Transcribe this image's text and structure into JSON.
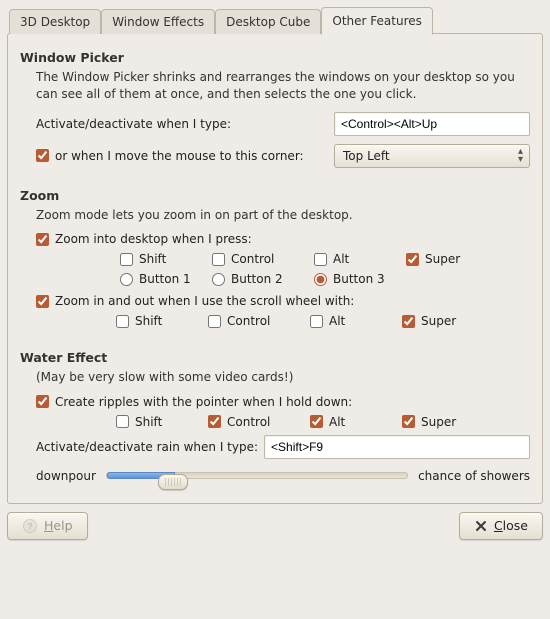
{
  "tabs": {
    "items": [
      "3D Desktop",
      "Window Effects",
      "Desktop Cube",
      "Other Features"
    ],
    "active_index": 3
  },
  "window_picker": {
    "title": "Window Picker",
    "desc": "The Window Picker shrinks and rearranges the windows on your desktop so you can see all of them at once, and then selects the one you click.",
    "activate_label": "Activate/deactivate when I type:",
    "activate_value": "<Control><Alt>Up",
    "corner_checked": true,
    "corner_label": "or when I move the mouse to this corner:",
    "corner_value": "Top Left"
  },
  "zoom": {
    "title": "Zoom",
    "desc": "Zoom mode lets you zoom in on part of the desktop.",
    "into_checked": true,
    "into_label": "Zoom into desktop when I press:",
    "mods": {
      "shift": {
        "label": "Shift",
        "checked": false
      },
      "control": {
        "label": "Control",
        "checked": false
      },
      "alt": {
        "label": "Alt",
        "checked": false
      },
      "super": {
        "label": "Super",
        "checked": true
      }
    },
    "buttons": {
      "b1": {
        "label": "Button 1",
        "selected": false
      },
      "b2": {
        "label": "Button 2",
        "selected": false
      },
      "b3": {
        "label": "Button 3",
        "selected": true
      }
    },
    "scroll_checked": true,
    "scroll_label": "Zoom in and out when I use the scroll wheel with:",
    "scroll_mods": {
      "shift": {
        "label": "Shift",
        "checked": false
      },
      "control": {
        "label": "Control",
        "checked": false
      },
      "alt": {
        "label": "Alt",
        "checked": false
      },
      "super": {
        "label": "Super",
        "checked": true
      }
    }
  },
  "water": {
    "title": "Water Effect",
    "note": "(May be very slow with some video cards!)",
    "ripples_checked": true,
    "ripples_label": "Create ripples with the pointer when I hold down:",
    "mods": {
      "shift": {
        "label": "Shift",
        "checked": false
      },
      "control": {
        "label": "Control",
        "checked": true
      },
      "alt": {
        "label": "Alt",
        "checked": true
      },
      "super": {
        "label": "Super",
        "checked": true
      }
    },
    "rain_label": "Activate/deactivate rain when I type:",
    "rain_value": "<Shift>F9",
    "slider_left": "downpour",
    "slider_right": "chance of showers",
    "slider_value_pct": 22
  },
  "buttons": {
    "help": "Help",
    "close": "Close"
  }
}
